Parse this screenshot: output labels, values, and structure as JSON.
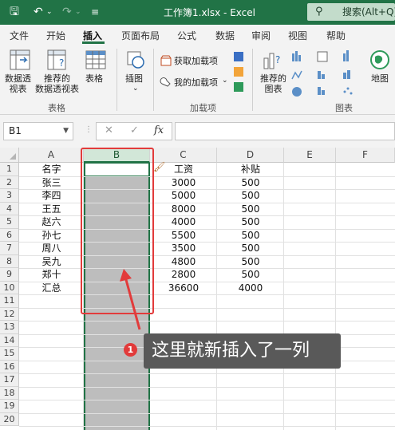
{
  "titlebar": {
    "title": "工作簿1.xlsx  -  Excel",
    "search_label": "搜索(Alt+Q)",
    "icons": [
      "save-icon",
      "undo-icon",
      "redo-icon",
      "customize-icon",
      "search-icon"
    ],
    "bg_color": "#217346"
  },
  "tabs": [
    "文件",
    "开始",
    "插入",
    "页面布局",
    "公式",
    "数据",
    "审阅",
    "视图",
    "帮助"
  ],
  "active_tab": "插入",
  "ribbon": {
    "pivot_line1": "数据透",
    "pivot_line2": "视表",
    "recpivot_line1": "推荐的",
    "recpivot_line2": "数据透视表",
    "table": "表格",
    "illustrations": "插图",
    "get_addins": "获取加载项",
    "my_addins": "我的加载项",
    "rec_charts_line1": "推荐的",
    "rec_charts_line2": "图表",
    "map": "地图",
    "group_tables": "表格",
    "group_addins": "加载项",
    "group_charts": "图表"
  },
  "formula_bar": {
    "name_box": "B1",
    "cancel": "✕",
    "enter": "✓",
    "fx": "fx",
    "content": ""
  },
  "grid": {
    "columns": [
      "A",
      "B",
      "C",
      "D",
      "E",
      "F"
    ],
    "selected_column": "B",
    "rows": [
      "1",
      "2",
      "3",
      "4",
      "5",
      "6",
      "7",
      "8",
      "9",
      "10",
      "11",
      "12",
      "13",
      "14",
      "15",
      "16",
      "17",
      "18",
      "19",
      "20"
    ],
    "data": [
      [
        "名字",
        "",
        "工资",
        "补贴"
      ],
      [
        "张三",
        "",
        "3000",
        "500"
      ],
      [
        "李四",
        "",
        "5000",
        "500"
      ],
      [
        "王五",
        "",
        "8000",
        "500"
      ],
      [
        "赵六",
        "",
        "4000",
        "500"
      ],
      [
        "孙七",
        "",
        "5500",
        "500"
      ],
      [
        "周八",
        "",
        "3500",
        "500"
      ],
      [
        "吴九",
        "",
        "4800",
        "500"
      ],
      [
        "郑十",
        "",
        "2800",
        "500"
      ],
      [
        "汇总",
        "",
        "36600",
        "4000"
      ]
    ]
  },
  "annotation": {
    "badge": "1",
    "text": "这里就新插入了一列"
  }
}
